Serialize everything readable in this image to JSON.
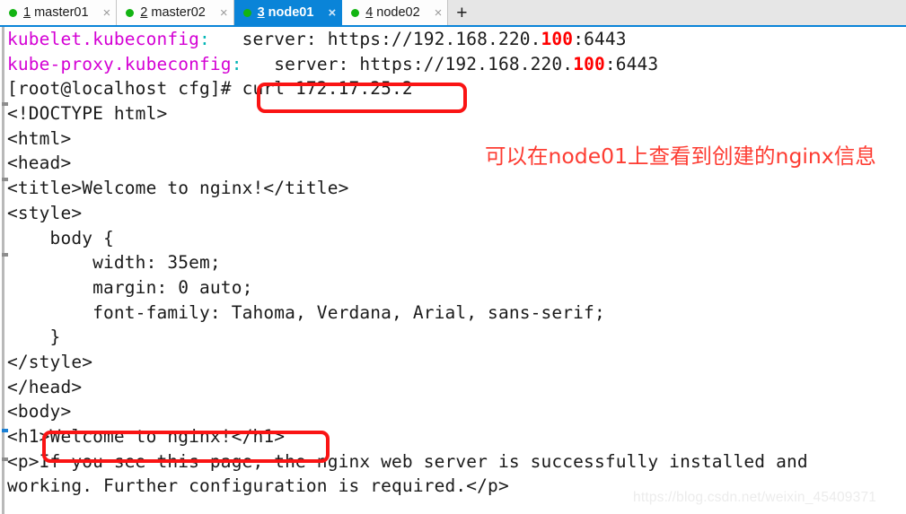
{
  "tabbar": {
    "tabs": [
      {
        "num": "1",
        "label": "master01",
        "active": false,
        "status_color": "#13b413",
        "close_icon": "×"
      },
      {
        "num": "2",
        "label": "master02",
        "active": false,
        "status_color": "#13b413",
        "close_icon": "×"
      },
      {
        "num": "3",
        "label": "node01",
        "active": true,
        "status_color": "#13b413",
        "close_icon": "×"
      },
      {
        "num": "4",
        "label": "node02",
        "active": false,
        "status_color": "#13b413",
        "close_icon": "×"
      }
    ],
    "add_tab_label": "+",
    "active_tab_color": "#0a84d8"
  },
  "terminal": {
    "background": "#ffffff",
    "foreground": "#1a1a1a",
    "lines": [
      {
        "id": "line-kubelet-kubeconfig",
        "segments": [
          {
            "text": "kubelet.kubeconfig",
            "color": "magenta"
          },
          {
            "text": ":",
            "color": "cyan"
          },
          {
            "text": "   server: https://192.168.220.",
            "color": "default"
          },
          {
            "text": "100",
            "color": "red"
          },
          {
            "text": ":6443",
            "color": "default"
          }
        ]
      },
      {
        "id": "line-kubeproxy-kubeconfig",
        "segments": [
          {
            "text": "kube-proxy.kubeconfig",
            "color": "magenta"
          },
          {
            "text": ":",
            "color": "cyan"
          },
          {
            "text": "   server: https://192.168.220.",
            "color": "default"
          },
          {
            "text": "100",
            "color": "red"
          },
          {
            "text": ":6443",
            "color": "default"
          }
        ]
      },
      {
        "id": "line-prompt-curl",
        "segments": [
          {
            "text": "[root@localhost cfg]# curl 172.17.25.2",
            "color": "default"
          }
        ]
      },
      {
        "id": "line-doctype",
        "segments": [
          {
            "text": "<!DOCTYPE html>",
            "color": "default"
          }
        ]
      },
      {
        "id": "line-html",
        "segments": [
          {
            "text": "<html>",
            "color": "default"
          }
        ]
      },
      {
        "id": "line-head",
        "segments": [
          {
            "text": "<head>",
            "color": "default"
          }
        ]
      },
      {
        "id": "line-title",
        "segments": [
          {
            "text": "<title>Welcome to nginx!</title>",
            "color": "default"
          }
        ]
      },
      {
        "id": "line-style",
        "segments": [
          {
            "text": "<style>",
            "color": "default"
          }
        ]
      },
      {
        "id": "line-body-sel",
        "segments": [
          {
            "text": "    body {",
            "color": "default"
          }
        ]
      },
      {
        "id": "line-width",
        "segments": [
          {
            "text": "        width: 35em;",
            "color": "default"
          }
        ]
      },
      {
        "id": "line-margin",
        "segments": [
          {
            "text": "        margin: 0 auto;",
            "color": "default"
          }
        ]
      },
      {
        "id": "line-fontfam",
        "segments": [
          {
            "text": "        font-family: Tahoma, Verdana, Arial, sans-serif;",
            "color": "default"
          }
        ]
      },
      {
        "id": "line-brace",
        "segments": [
          {
            "text": "    }",
            "color": "default"
          }
        ]
      },
      {
        "id": "line-style-end",
        "segments": [
          {
            "text": "</style>",
            "color": "default"
          }
        ]
      },
      {
        "id": "line-head-end",
        "segments": [
          {
            "text": "</head>",
            "color": "default"
          }
        ]
      },
      {
        "id": "line-body",
        "segments": [
          {
            "text": "<body>",
            "color": "default"
          }
        ]
      },
      {
        "id": "line-h1",
        "segments": [
          {
            "text": "<h1>Welcome to nginx!</h1>",
            "color": "default"
          }
        ]
      },
      {
        "id": "line-p1",
        "segments": [
          {
            "text": "<p>If you see this page, the nginx web server is successfully installed and",
            "color": "default"
          }
        ]
      },
      {
        "id": "line-p2",
        "segments": [
          {
            "text": "working. Further configuration is required.</p>",
            "color": "default"
          }
        ]
      }
    ]
  },
  "annotations": {
    "highlight_color": "#fa1414",
    "boxes": [
      {
        "id": "redbox-curl",
        "target_text": "curl 172.17.25.2"
      },
      {
        "id": "redbox-h1",
        "target_text": ">Welcome to nginx!</h1>"
      }
    ],
    "note_text": "可以在node01上查看到创建的nginx信息",
    "note_color": "#fd3c32"
  },
  "watermark": {
    "text": "https://blog.csdn.net/weixin_45409371"
  }
}
